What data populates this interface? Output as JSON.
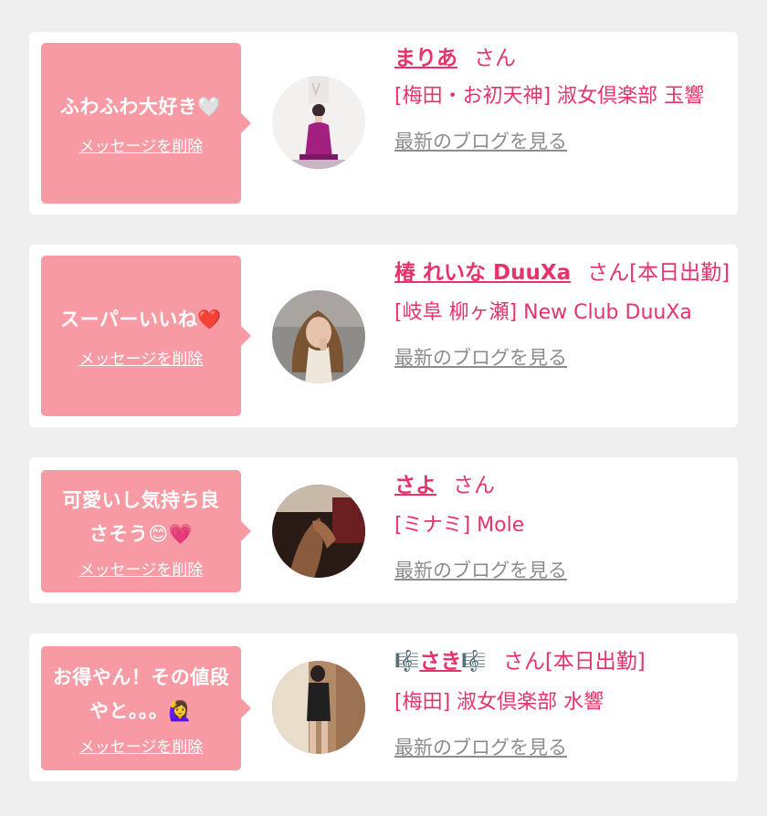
{
  "cards": [
    {
      "message": "ふわふわ大好き🤍",
      "delete_label": "メッセージを削除",
      "name": "まりあ",
      "honorific": "さん",
      "shop": "[梅田・お初天神] 淑女倶楽部 玉響",
      "blog_label": "最新のブログを見る"
    },
    {
      "message": "スーパーいいね❤️",
      "delete_label": "メッセージを削除",
      "name": "椿 れいな DuuXa",
      "honorific": "さん[本日出勤]",
      "shop": "[岐阜 柳ヶ瀬] New Club DuuXa",
      "blog_label": "最新のブログを見る"
    },
    {
      "message": "可愛いし気持ち良さそう😊💗",
      "delete_label": "メッセージを削除",
      "name": "さよ",
      "honorific": "さん",
      "shop": "[ミナミ] Mole",
      "blog_label": "最新のブログを見る"
    },
    {
      "message": "お得やん！その値段やと。。。🙋‍♀️",
      "delete_label": "メッセージを削除",
      "name": "さき",
      "name_decoration": "🎼",
      "honorific": "さん[本日出勤]",
      "shop": "[梅田] 淑女倶楽部 水響",
      "blog_label": "最新のブログを見る"
    }
  ]
}
